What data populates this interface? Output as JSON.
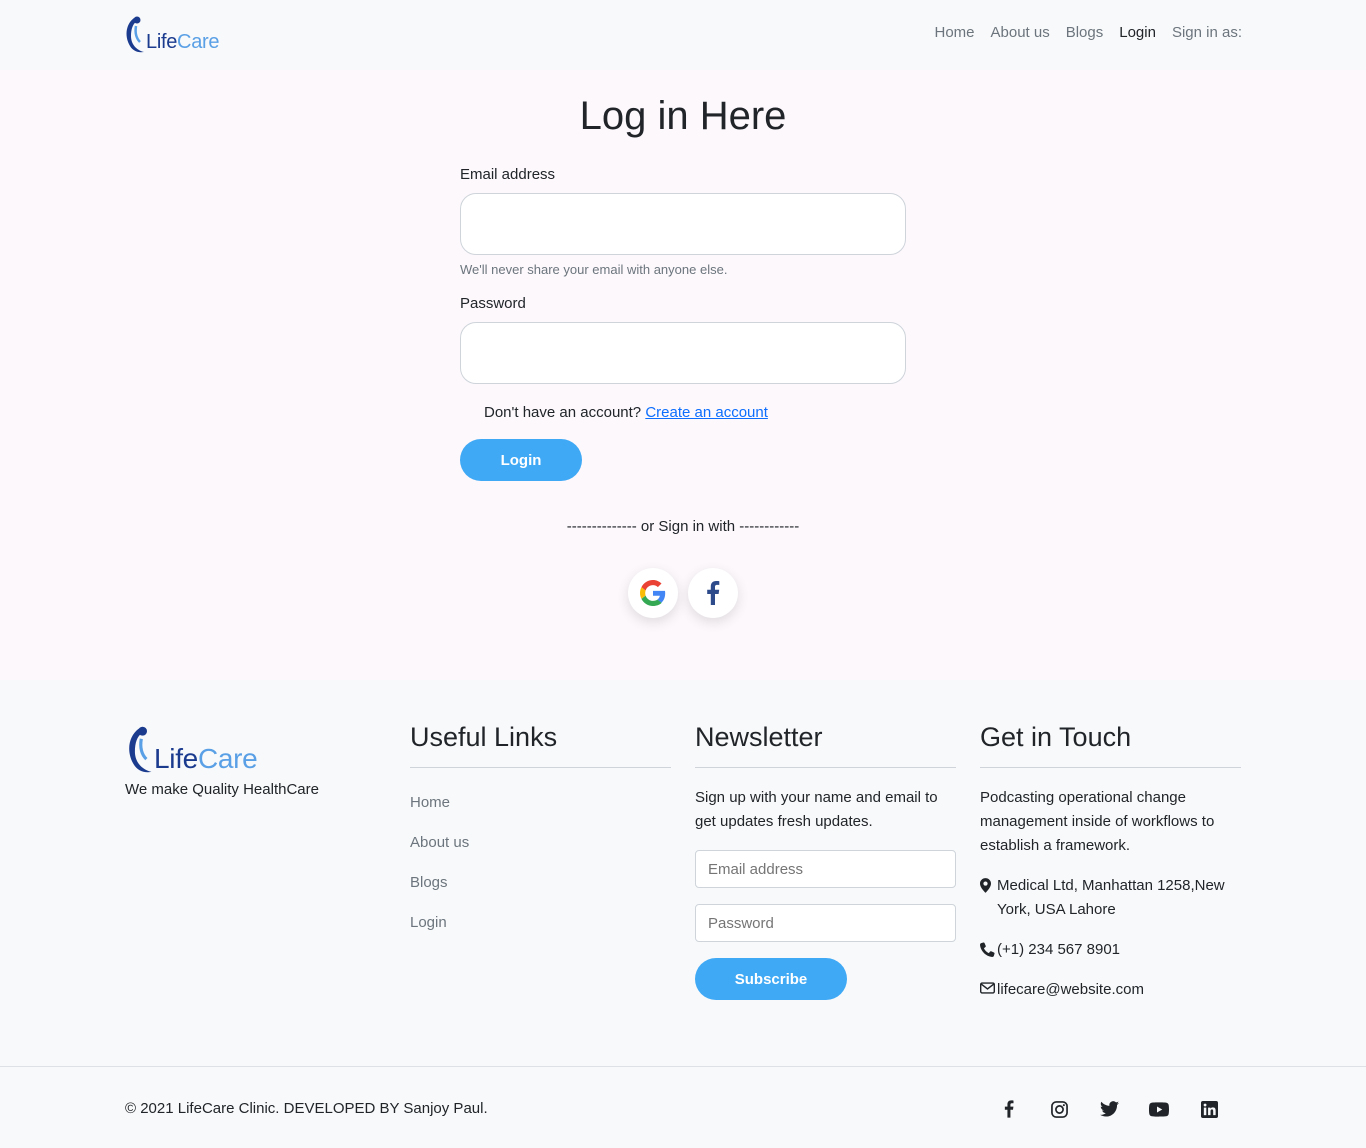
{
  "nav": {
    "brand": {
      "life": "Life",
      "care": "Care"
    },
    "links": [
      "Home",
      "About us",
      "Blogs",
      "Login",
      "Sign in as:"
    ],
    "active": "Login"
  },
  "login": {
    "title": "Log in Here",
    "email_label": "Email address",
    "email_helper": "We'll never share your email with anyone else.",
    "password_label": "Password",
    "no_account_text": "Don't have an account?",
    "create_account_link": "Create an account",
    "login_button": "Login",
    "or_sign_in_with": "-------------- or Sign in with ------------",
    "providers": [
      "google-icon",
      "facebook-icon"
    ]
  },
  "footer": {
    "brand": {
      "life": "Life",
      "care": "Care"
    },
    "tagline": "We make Quality HealthCare",
    "useful_links": {
      "heading": "Useful Links",
      "items": [
        "Home",
        "About us",
        "Blogs",
        "Login"
      ]
    },
    "newsletter": {
      "heading": "Newsletter",
      "text": "Sign up with your name and email to get updates fresh updates.",
      "email_placeholder": "Email address",
      "password_placeholder": "Password",
      "subscribe_button": "Subscribe"
    },
    "get_in_touch": {
      "heading": "Get in Touch",
      "description": "Podcasting operational change management inside of workflows to establish a framework.",
      "address": "Medical Ltd, Manhattan 1258,New York, USA Lahore",
      "phone": "(+1) 234 567 8901",
      "email": "lifecare@website.com"
    }
  },
  "bottom": {
    "copyright": "© 2021 LifeCare Clinic. DEVELOPED BY Sanjoy Paul.",
    "social": [
      "facebook-icon",
      "instagram-icon",
      "twitter-icon",
      "youtube-icon",
      "linkedin-icon"
    ]
  },
  "colors": {
    "accent": "#3fa9f5",
    "brand_dark": "#1b3b8f",
    "brand_light": "#5aa0e6",
    "link": "#0d6efd"
  }
}
